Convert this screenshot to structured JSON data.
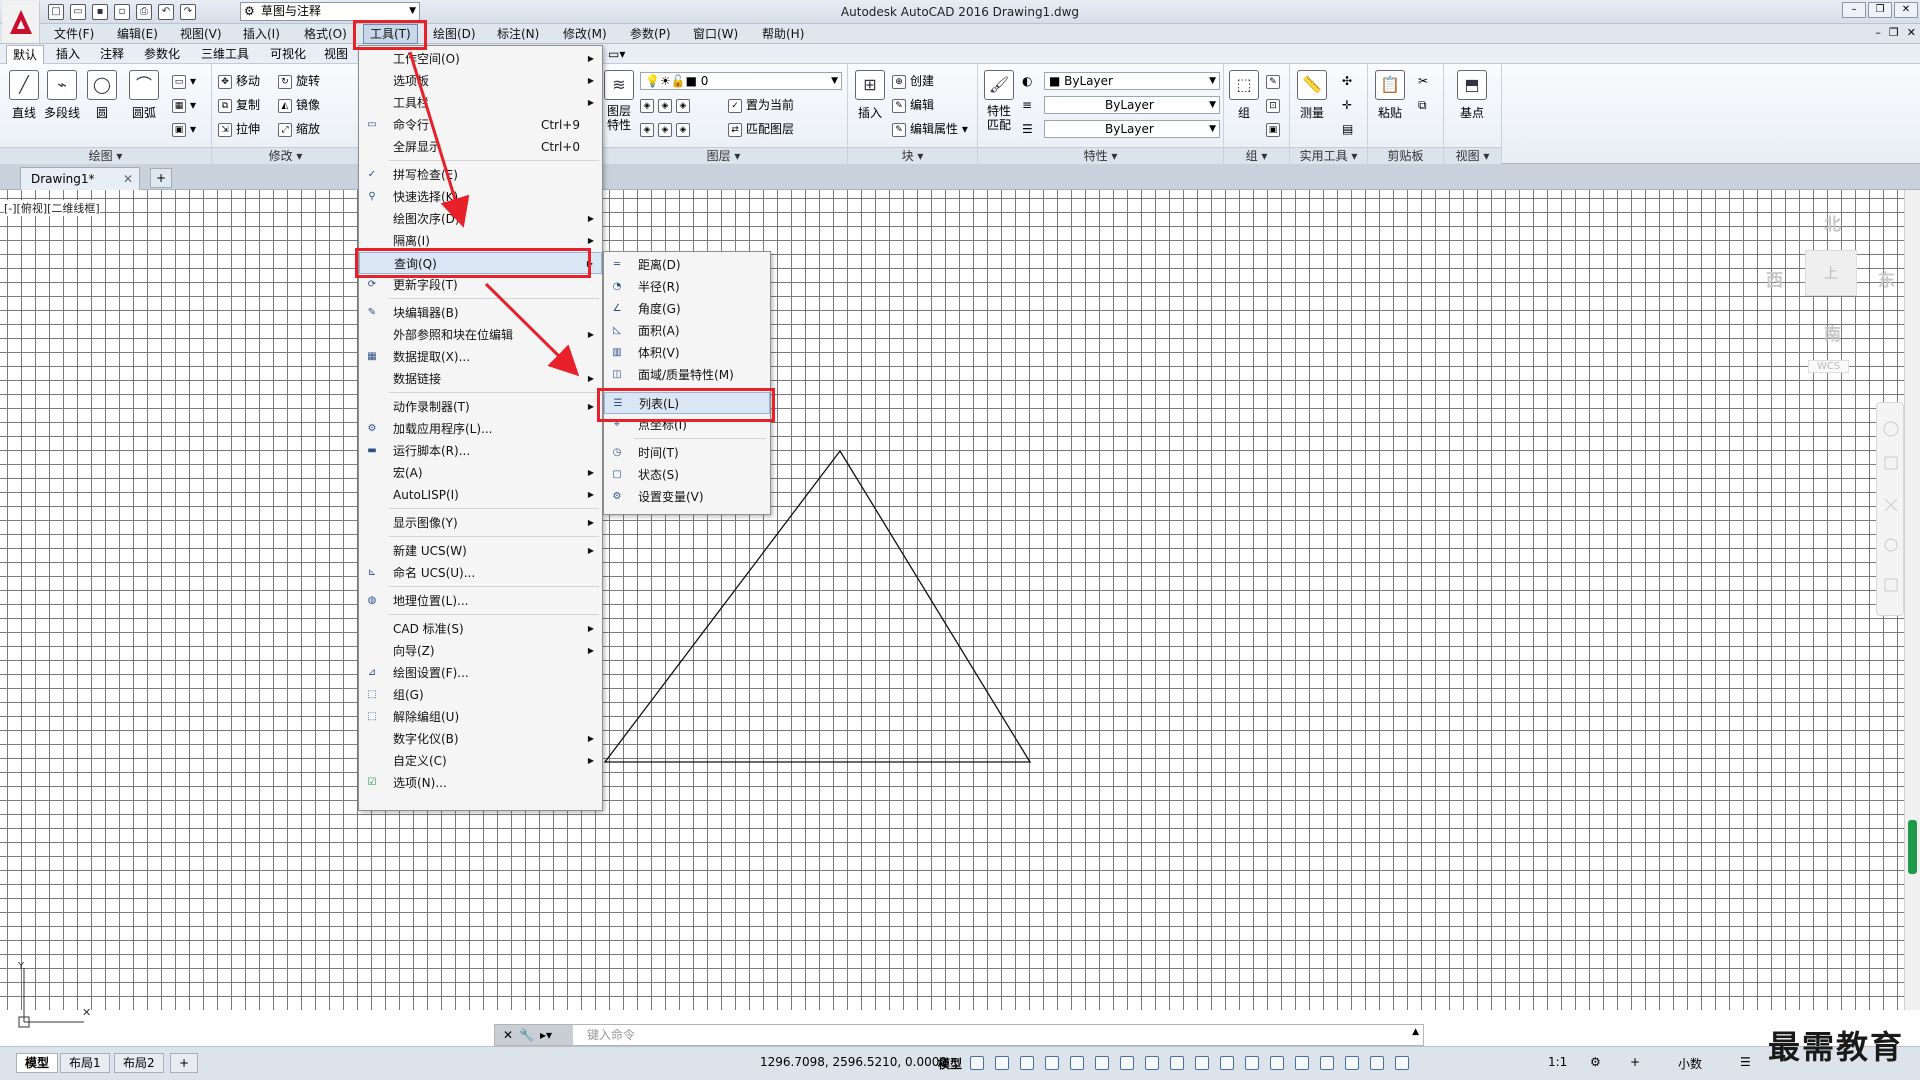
{
  "window": {
    "title": "Autodesk AutoCAD 2016    Drawing1.dwg",
    "workspace": "草图与注释"
  },
  "menubar": {
    "items": [
      "文件(F)",
      "编辑(E)",
      "视图(V)",
      "插入(I)",
      "格式(O)",
      "工具(T)",
      "绘图(D)",
      "标注(N)",
      "修改(M)",
      "参数(P)",
      "窗口(W)",
      "帮助(H)"
    ]
  },
  "ribbon": {
    "tabs": [
      "默认",
      "插入",
      "注释",
      "参数化",
      "三维工具",
      "可视化",
      "视图"
    ],
    "draw": {
      "label": "绘图",
      "line": "直线",
      "polyline": "多段线",
      "circle": "圆",
      "arc": "圆弧"
    },
    "modify": {
      "label": "修改",
      "move": "移动",
      "rotate": "旋转",
      "copy": "复制",
      "mirror": "镜像",
      "stretch": "拉伸",
      "scale": "缩放"
    },
    "layers": {
      "label": "图层",
      "properties": "图层\n特性",
      "current_layer": "0",
      "set_current": "置为当前",
      "match_layer": "匹配图层"
    },
    "block": {
      "label": "块",
      "insert": "插入",
      "create": "创建",
      "edit": "编辑",
      "edit_attr": "编辑属性"
    },
    "properties": {
      "label": "特性",
      "match": "特性\n匹配",
      "color": "ByLayer",
      "linetype": "ByLayer",
      "lineweight": "ByLayer"
    },
    "groups": {
      "label": "组",
      "group": "组"
    },
    "utilities": {
      "label": "实用工具",
      "measure": "测量"
    },
    "clipboard": {
      "label": "剪贴板",
      "paste": "粘贴"
    },
    "view": {
      "label": "视图",
      "base": "基点"
    }
  },
  "document": {
    "tab": "Drawing1*",
    "viewport_label": "[-][俯视][二维线框]"
  },
  "viewcube": {
    "north": "北",
    "south": "南",
    "east": "东",
    "west": "西",
    "top": "上",
    "wcs": "WCS"
  },
  "tools_menu": {
    "items": [
      {
        "label": "工作空间(O)",
        "sub": true
      },
      {
        "label": "选项板",
        "sub": true
      },
      {
        "label": "工具栏",
        "sub": true
      },
      {
        "label": "命令行",
        "shortcut": "Ctrl+9"
      },
      {
        "label": "全屏显示",
        "shortcut": "Ctrl+0"
      },
      {
        "label": "拼写检查(E)"
      },
      {
        "label": "快速选择(K)..."
      },
      {
        "label": "绘图次序(D)",
        "sub": true
      },
      {
        "label": "隔离(I)",
        "sub": true
      },
      {
        "label": "查询(Q)",
        "sub": true
      },
      {
        "label": "更新字段(T)"
      },
      {
        "label": "块编辑器(B)"
      },
      {
        "label": "外部参照和块在位编辑",
        "sub": true
      },
      {
        "label": "数据提取(X)..."
      },
      {
        "label": "数据链接",
        "sub": true
      },
      {
        "label": "动作录制器(T)",
        "sub": true
      },
      {
        "label": "加载应用程序(L)..."
      },
      {
        "label": "运行脚本(R)..."
      },
      {
        "label": "宏(A)",
        "sub": true
      },
      {
        "label": "AutoLISP(I)",
        "sub": true
      },
      {
        "label": "显示图像(Y)",
        "sub": true
      },
      {
        "label": "新建 UCS(W)",
        "sub": true
      },
      {
        "label": "命名 UCS(U)..."
      },
      {
        "label": "地理位置(L)..."
      },
      {
        "label": "CAD 标准(S)",
        "sub": true
      },
      {
        "label": "向导(Z)",
        "sub": true
      },
      {
        "label": "绘图设置(F)..."
      },
      {
        "label": "组(G)"
      },
      {
        "label": "解除编组(U)"
      },
      {
        "label": "数字化仪(B)",
        "sub": true
      },
      {
        "label": "自定义(C)",
        "sub": true
      },
      {
        "label": "选项(N)..."
      }
    ]
  },
  "inquiry_menu": {
    "items": [
      "距离(D)",
      "半径(R)",
      "角度(G)",
      "面积(A)",
      "体积(V)",
      "面域/质量特性(M)",
      "列表(L)",
      "点坐标(I)",
      "时间(T)",
      "状态(S)",
      "设置变量(V)"
    ]
  },
  "command_line": {
    "placeholder": "键入命令"
  },
  "layout_tabs": [
    "模型",
    "布局1",
    "布局2"
  ],
  "status": {
    "coords": "1296.7098, 2596.5210, 0.0000",
    "model": "模型",
    "scale": "1:1",
    "units": "小数"
  },
  "watermark": "最需教育",
  "accent_colors": {
    "highlight_red": "#e8202a",
    "selection_blue": "#dbe6f4",
    "scroll_green": "#1e9a4a"
  }
}
